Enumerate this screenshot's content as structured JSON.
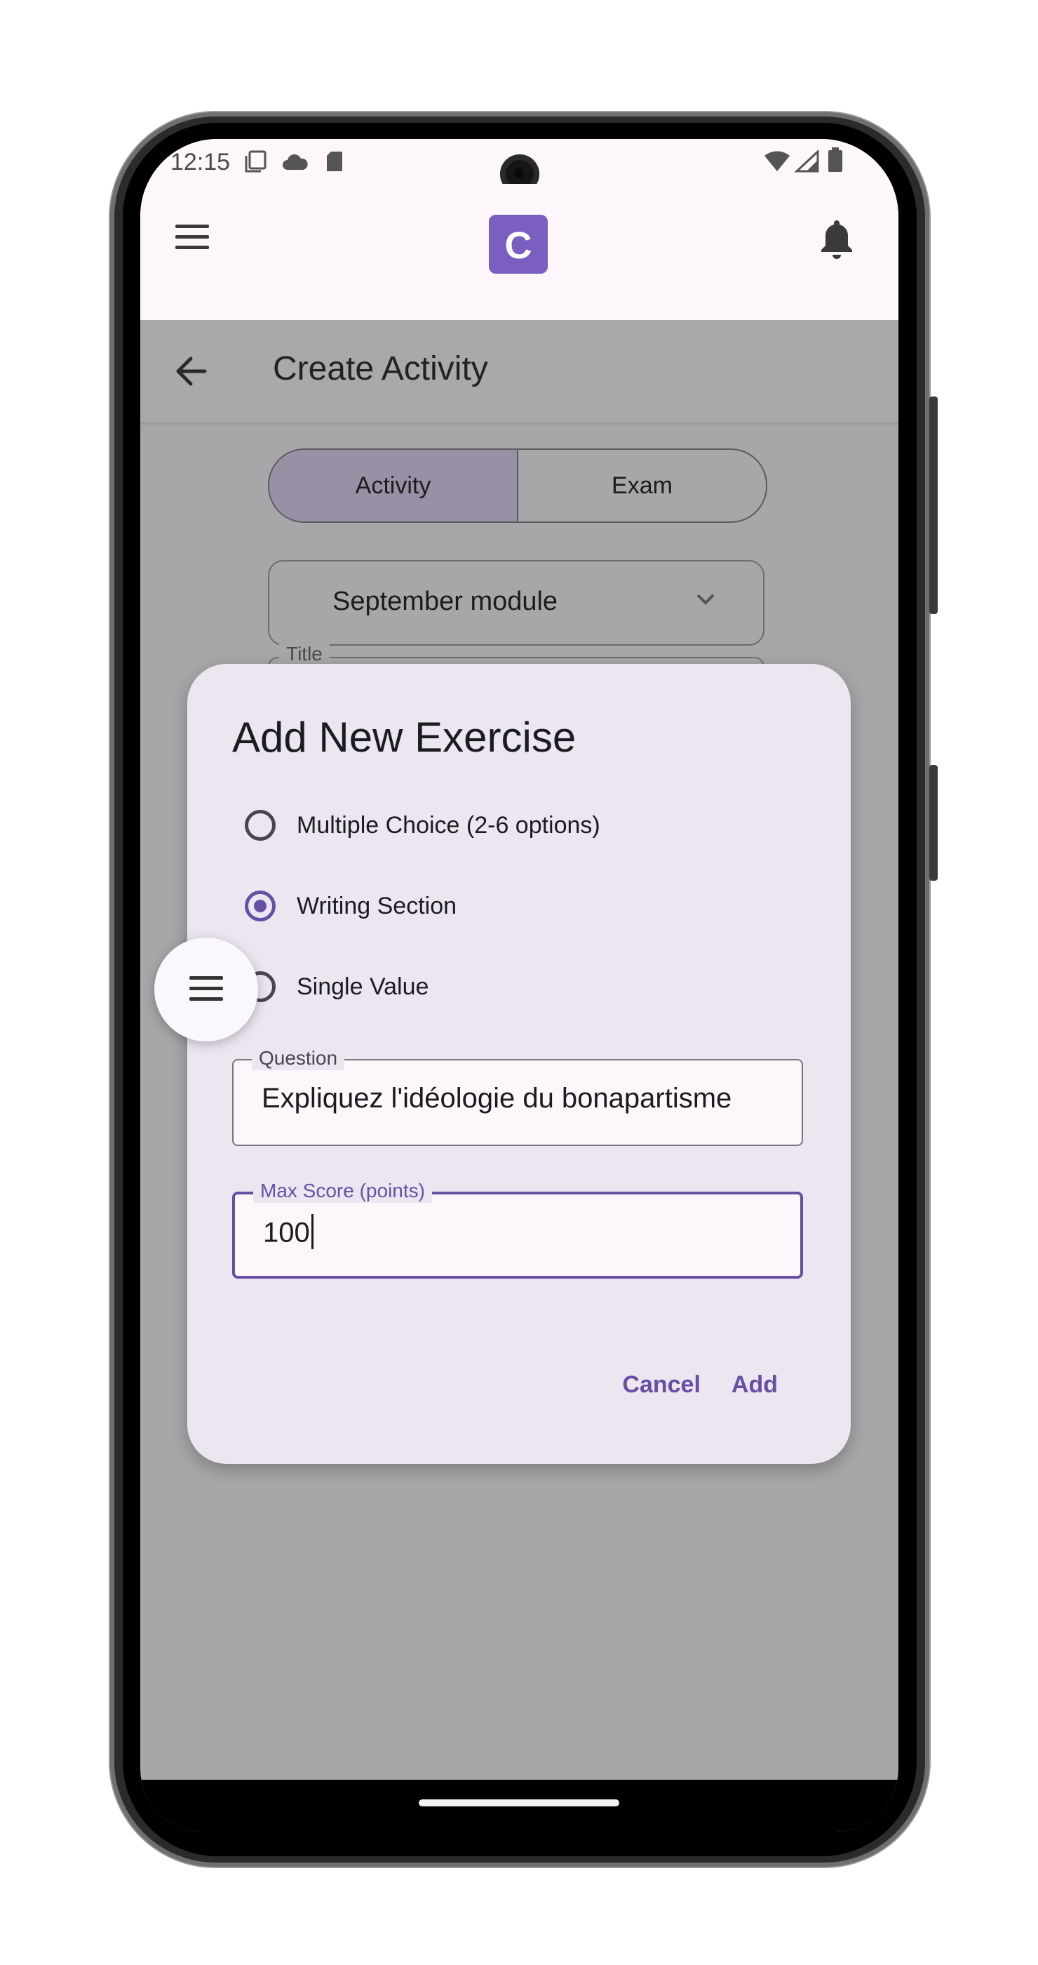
{
  "status_bar": {
    "time": "12:15",
    "icons": [
      "screen-icon",
      "cloud-icon",
      "sd-card-icon",
      "wifi-icon",
      "signal-icon",
      "battery-icon"
    ]
  },
  "app_bar": {
    "logo_letter": "C",
    "menu_icon": "menu-icon",
    "notification_icon": "bell-icon"
  },
  "page": {
    "title": "Create Activity",
    "segments": [
      {
        "label": "Activity",
        "selected": true
      },
      {
        "label": "Exam",
        "selected": false
      }
    ],
    "module_select": {
      "value": "September module"
    },
    "title_field": {
      "label": "Title"
    }
  },
  "dialog": {
    "title": "Add New Exercise",
    "options": [
      {
        "label": "Multiple Choice (2-6 options)",
        "selected": false
      },
      {
        "label": "Writing Section",
        "selected": true
      },
      {
        "label": "Single Value",
        "selected": false
      }
    ],
    "question": {
      "label": "Question",
      "value": "Expliquez l'idéologie du bonapartisme"
    },
    "max_score": {
      "label": "Max Score (points)",
      "value": "100"
    },
    "cancel_label": "Cancel",
    "add_label": "Add"
  },
  "colors": {
    "accent": "#6750a4",
    "logo": "#7b5ec1",
    "scrim": "#a7a7a9",
    "dialog_bg": "#ece6f0"
  }
}
